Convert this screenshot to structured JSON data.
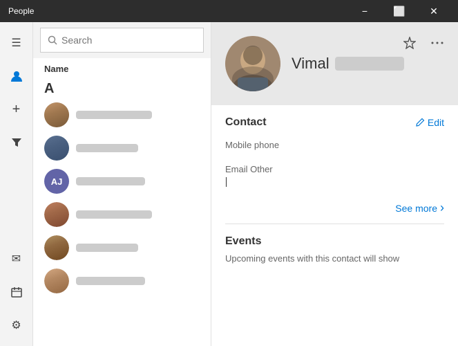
{
  "titlebar": {
    "title": "People",
    "minimize_label": "−",
    "maximize_label": "⬜",
    "close_label": "✕"
  },
  "rail": {
    "icons": [
      {
        "name": "hamburger-icon",
        "glyph": "☰",
        "active": false
      },
      {
        "name": "person-icon",
        "glyph": "👤",
        "active": true
      },
      {
        "name": "add-icon",
        "glyph": "+",
        "active": false
      },
      {
        "name": "filter-icon",
        "glyph": "⚡",
        "active": false
      },
      {
        "name": "mail-icon",
        "glyph": "✉",
        "active": false
      },
      {
        "name": "calendar-icon",
        "glyph": "📅",
        "active": false
      },
      {
        "name": "settings-icon",
        "glyph": "⚙",
        "active": false
      }
    ]
  },
  "contact_panel": {
    "search_placeholder": "Search",
    "list_header": "Name",
    "alpha_group": "A",
    "contacts": [
      {
        "id": 1,
        "type": "photo",
        "photo_class": "avatar-photo-1"
      },
      {
        "id": 2,
        "type": "photo",
        "photo_class": "avatar-photo-2"
      },
      {
        "id": 3,
        "type": "initials",
        "initials": "AJ",
        "bg": "#6264a7"
      },
      {
        "id": 4,
        "type": "photo",
        "photo_class": "avatar-photo-3"
      },
      {
        "id": 5,
        "type": "photo",
        "photo_class": "avatar-photo-4"
      },
      {
        "id": 6,
        "type": "photo",
        "photo_class": "avatar-photo-1"
      }
    ]
  },
  "detail": {
    "name_first": "Vimal",
    "pin_icon": "📌",
    "more_icon": "•••",
    "edit_icon": "✏",
    "edit_label": "Edit",
    "contact_section_title": "Contact",
    "fields": [
      {
        "label": "Mobile phone",
        "value": ""
      },
      {
        "label": "Email Other",
        "value": ""
      }
    ],
    "see_more_label": "See more",
    "chevron_right": "›",
    "events_title": "Events",
    "events_text": "Upcoming events with this contact will show"
  }
}
